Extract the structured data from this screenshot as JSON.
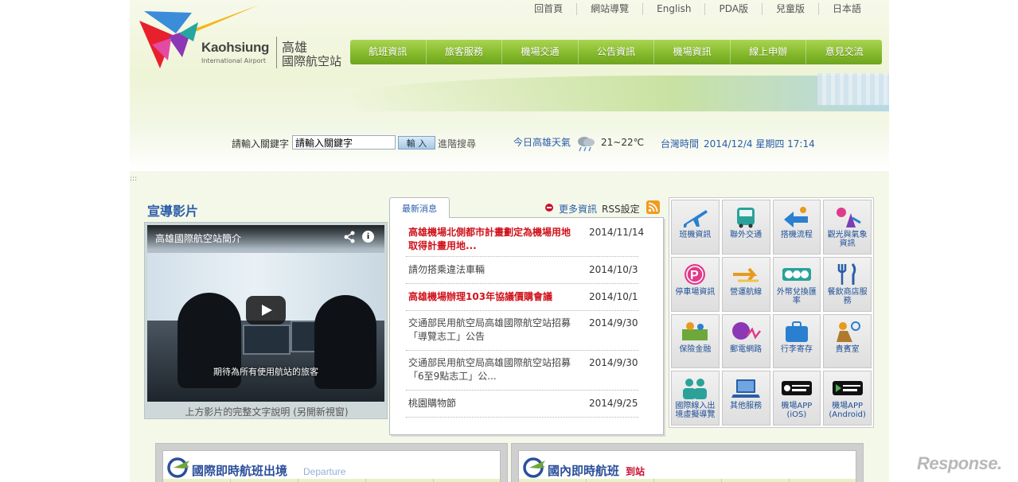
{
  "header": {
    "logo_en": "Kaohsiung",
    "logo_sub": "International Airport",
    "logo_zh_line1": "高雄",
    "logo_zh_line2": "國際航空站"
  },
  "top_links": [
    "回首頁",
    "網站導覽",
    "English",
    "PDA版",
    "兒童版",
    "日本語"
  ],
  "main_nav": [
    "航班資訊",
    "旅客服務",
    "機場交通",
    "公告資訊",
    "機場資訊",
    "線上申辦",
    "意見交流"
  ],
  "search": {
    "label": "請輸入關鍵字",
    "input_value": "請輸入關鍵字",
    "button": "輸 入",
    "advanced": "進階搜尋"
  },
  "weather": {
    "label": "今日高雄天氣",
    "temperature": "21~22℃",
    "icon": "cloudy-rain-icon"
  },
  "time": {
    "label": "台灣時間",
    "value": "2014/12/4 星期四 17:14"
  },
  "separator": ":::",
  "video": {
    "section_title": "宣導影片",
    "player_title": "高雄國際航空站簡介",
    "subtitle": "期待為所有使用航站的旅客",
    "description": "上方影片的完整文字說明 (另開新視窗)"
  },
  "news": {
    "tab_label": "最新消息",
    "more_link": "更多資訊",
    "rss_link": "RSS設定",
    "items": [
      {
        "title": "高雄機場北側都市計畫劃定為機場用地取得計畫用地...",
        "date": "2014/11/14",
        "highlight": true
      },
      {
        "title": "請勿搭乘違法車輛",
        "date": "2014/10/3",
        "highlight": false
      },
      {
        "title": "高雄機場辦理103年協議價購會議",
        "date": "2014/10/1",
        "highlight": true
      },
      {
        "title": "交通部民用航空局高雄國際航空站招募「導覽志工」公告",
        "date": "2014/9/30",
        "highlight": false
      },
      {
        "title": "交通部民用航空局高雄國際航空站招募「6至9點志工」公...",
        "date": "2014/9/30",
        "highlight": false
      },
      {
        "title": "桃園購物節",
        "date": "2014/9/25",
        "highlight": false
      }
    ]
  },
  "services": [
    {
      "label": "班機資訊",
      "icon": "airplane-icon"
    },
    {
      "label": "聯外交通",
      "icon": "bus-icon"
    },
    {
      "label": "搭機流程",
      "icon": "boarding-process-icon"
    },
    {
      "label": "觀光與氣象資訊",
      "icon": "tourism-weather-icon"
    },
    {
      "label": "停車場資訊",
      "icon": "parking-icon"
    },
    {
      "label": "營運航線",
      "icon": "routes-icon"
    },
    {
      "label": "外幣兌換匯率",
      "icon": "currency-exchange-icon"
    },
    {
      "label": "餐飲商店服務",
      "icon": "dining-icon"
    },
    {
      "label": "保險金融",
      "icon": "insurance-icon"
    },
    {
      "label": "郵電網路",
      "icon": "phone-network-icon"
    },
    {
      "label": "行李寄存",
      "icon": "luggage-icon"
    },
    {
      "label": "貴賓室",
      "icon": "vip-lounge-icon"
    },
    {
      "label": "國際線入出境虛擬導覽",
      "icon": "virtual-tour-icon"
    },
    {
      "label": "其他服務",
      "icon": "laptop-icon"
    },
    {
      "label": "機場APP (iOS)",
      "icon": "app-store-icon"
    },
    {
      "label": "機場APP (Android)",
      "icon": "google-play-icon"
    }
  ],
  "flights": {
    "intl_title": "國際即時航班出境",
    "intl_sub": "Departure",
    "dom_title": "國內即時航班",
    "dom_sub": "到站"
  },
  "watermark": "Response."
}
